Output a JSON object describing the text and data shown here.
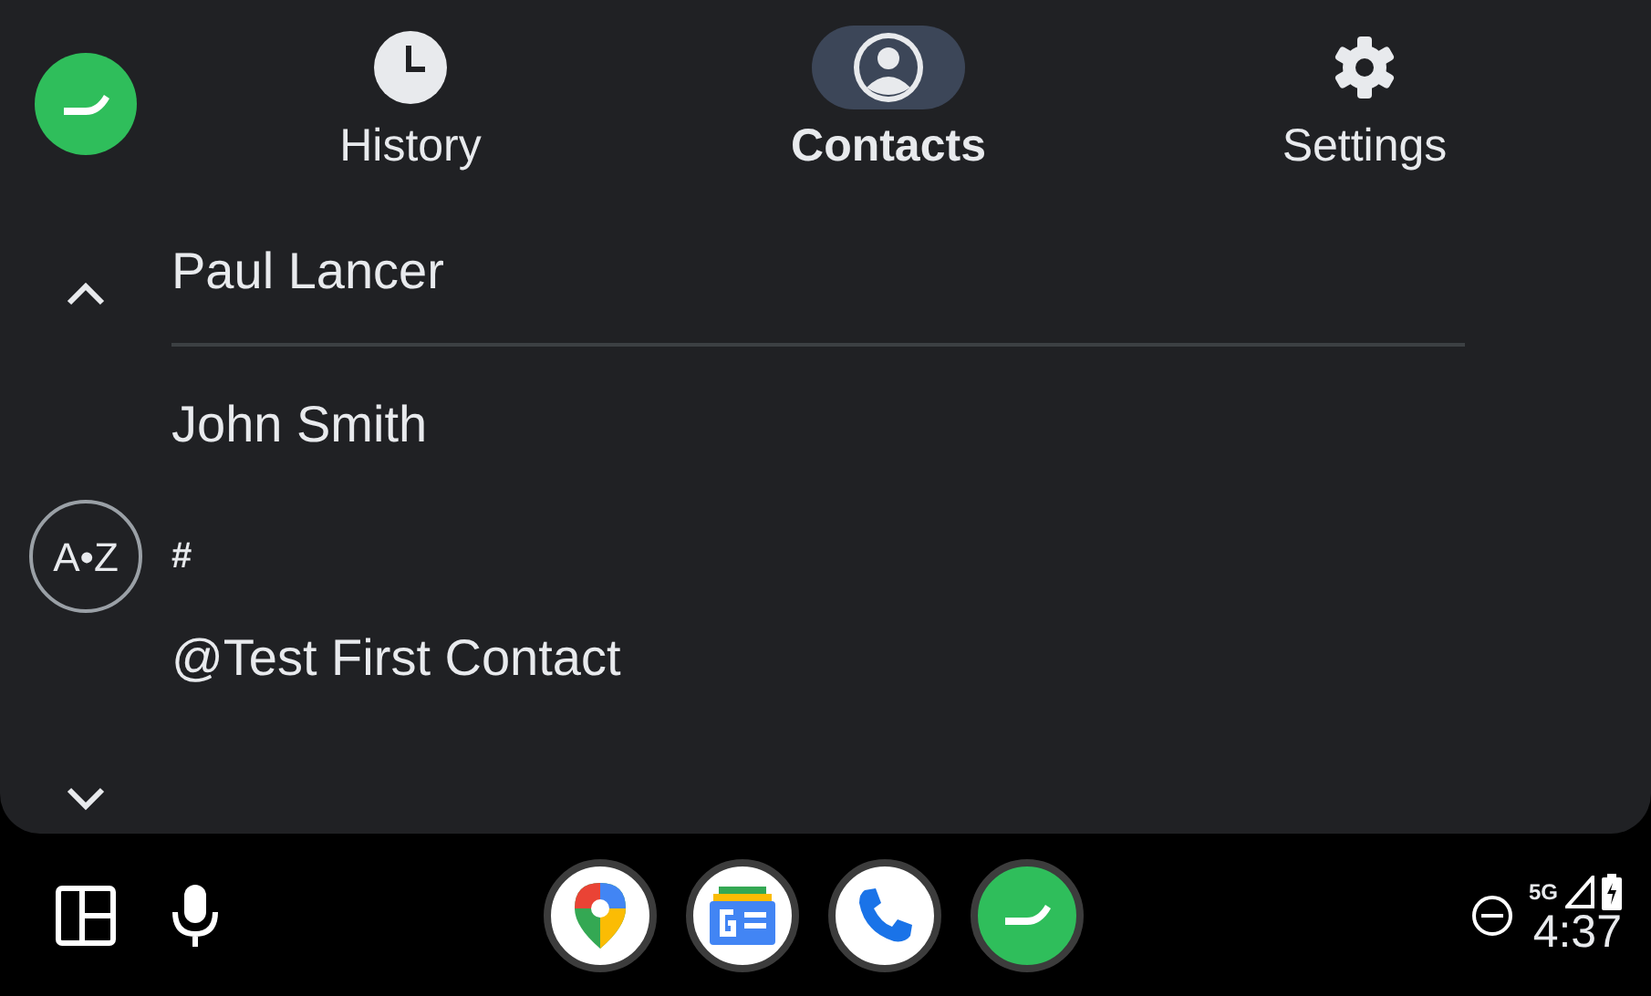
{
  "tabs": [
    {
      "label": "History",
      "selected": false
    },
    {
      "label": "Contacts",
      "selected": true
    },
    {
      "label": "Settings",
      "selected": false
    }
  ],
  "contacts": [
    {
      "kind": "contact",
      "text": "Paul Lancer",
      "divider": true
    },
    {
      "kind": "contact",
      "text": "John Smith",
      "divider": false
    },
    {
      "kind": "header",
      "text": "#",
      "divider": false
    },
    {
      "kind": "contact",
      "text": "@Test First Contact",
      "divider": false
    }
  ],
  "alphabet_button": {
    "label": "A•Z"
  },
  "status": {
    "network": "5G",
    "time": "4:37"
  }
}
